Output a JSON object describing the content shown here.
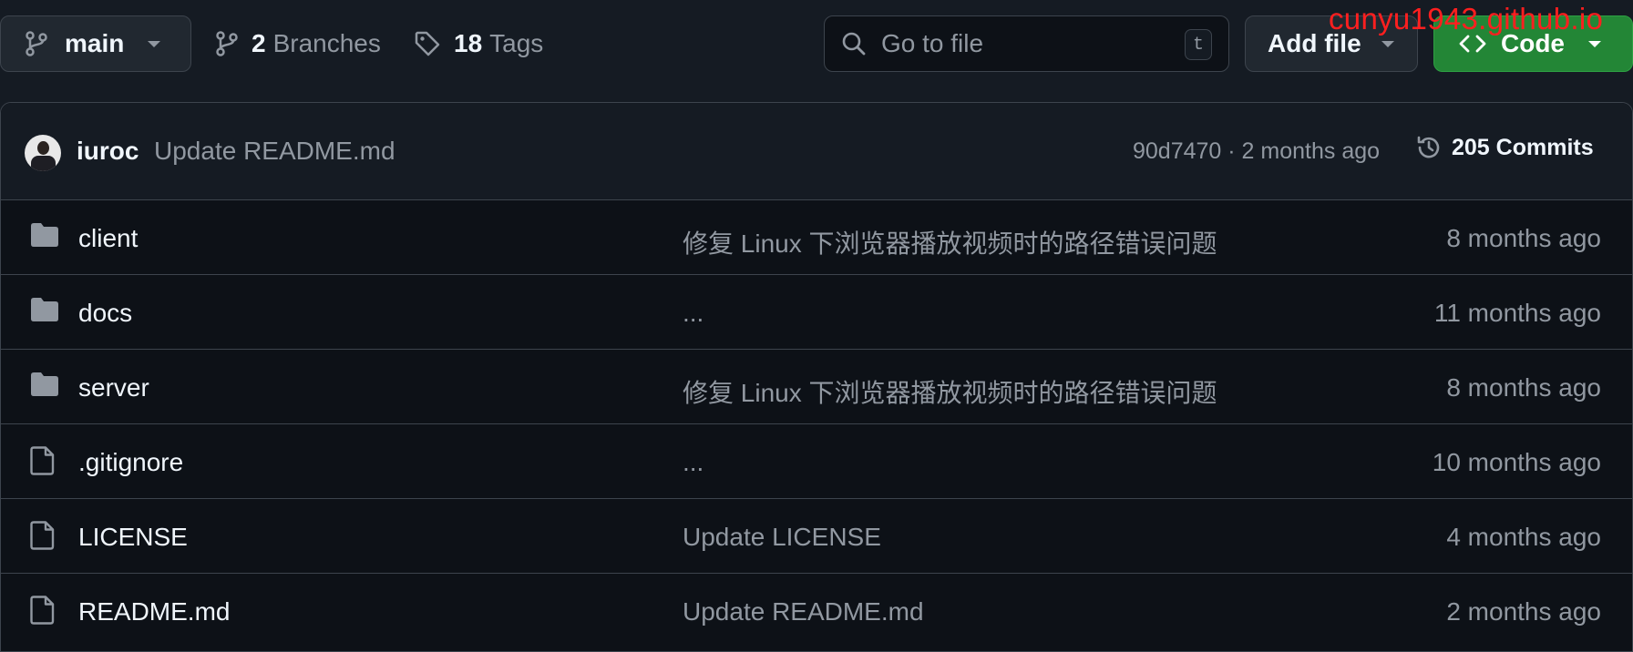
{
  "toolbar": {
    "branch": "main",
    "branches_count": "2",
    "branches_label": "Branches",
    "tags_count": "18",
    "tags_label": "Tags",
    "search_placeholder": "Go to file",
    "search_shortcut": "t",
    "add_file_label": "Add file",
    "code_label": "Code"
  },
  "watermark": "cunyu1943.github.io",
  "latest_commit": {
    "author": "iuroc",
    "message": "Update README.md",
    "sha_time": "90d7470 · 2 months ago",
    "commits_label": "205 Commits"
  },
  "files": [
    {
      "name": "client",
      "type": "folder",
      "message": "修复 Linux 下浏览器播放视频时的路径错误问题",
      "date": "8 months ago"
    },
    {
      "name": "docs",
      "type": "folder",
      "message": "...",
      "date": "11 months ago"
    },
    {
      "name": "server",
      "type": "folder",
      "message": "修复 Linux 下浏览器播放视频时的路径错误问题",
      "date": "8 months ago"
    },
    {
      "name": ".gitignore",
      "type": "file",
      "message": "...",
      "date": "10 months ago"
    },
    {
      "name": "LICENSE",
      "type": "file",
      "message": "Update LICENSE",
      "date": "4 months ago"
    },
    {
      "name": "README.md",
      "type": "file",
      "message": "Update README.md",
      "date": "2 months ago"
    }
  ],
  "colors": {
    "background": "#151b23",
    "border": "#3d444d",
    "primary_button": "#238636",
    "muted_text": "#9198a1",
    "watermark": "#ff1f1f"
  }
}
